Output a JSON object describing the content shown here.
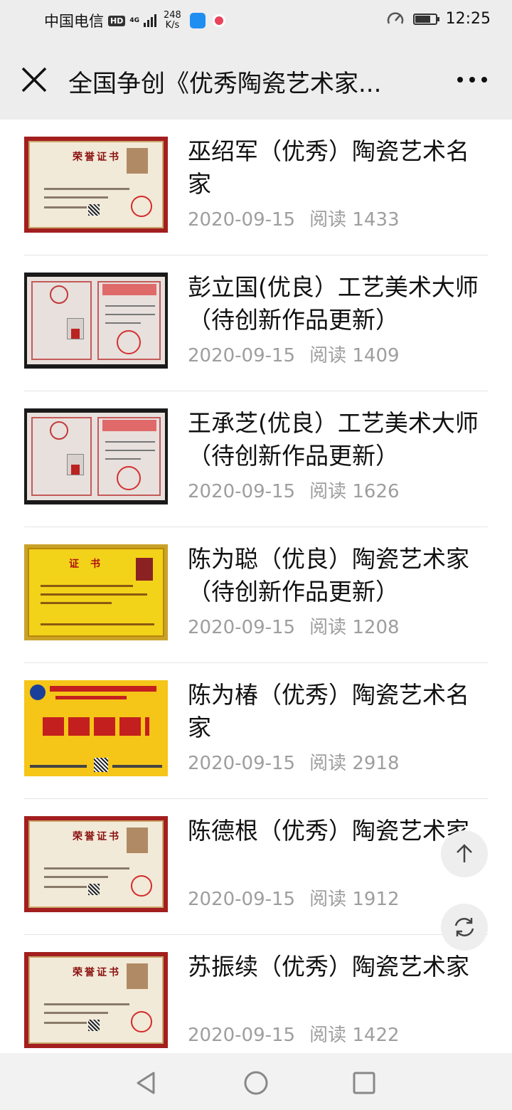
{
  "status_bar": {
    "carrier": "中国电信",
    "hd": "HD",
    "network": "4G",
    "speed_value": "248",
    "speed_unit": "K/s",
    "battery_level": 0.75,
    "time": "12:25"
  },
  "header": {
    "title": "全国争创《优秀陶瓷艺术家...",
    "close_icon": "close-icon",
    "more_icon": "more-icon"
  },
  "articles": [
    {
      "title": "巫绍军（优秀）陶瓷艺术名家",
      "date": "2020-09-15",
      "reads": "阅读 1433",
      "thumb": "certificate-cream"
    },
    {
      "title": "彭立国(优良）工艺美术大师（待创新作品更新）",
      "date": "2020-09-15",
      "reads": "阅读 1409",
      "thumb": "certificate-open"
    },
    {
      "title": "王承芝(优良）工艺美术大师（待创新作品更新）",
      "date": "2020-09-15",
      "reads": "阅读 1626",
      "thumb": "certificate-open"
    },
    {
      "title": "陈为聪（优良）陶瓷艺术家（待创新作品更新）",
      "date": "2020-09-15",
      "reads": "阅读 1208",
      "thumb": "certificate-gold"
    },
    {
      "title": "陈为椿（优秀）陶瓷艺术名家",
      "date": "2020-09-15",
      "reads": "阅读 2918",
      "thumb": "certificate-banner"
    },
    {
      "title": "陈德根（优秀）陶瓷艺术家",
      "date": "2020-09-15",
      "reads": "阅读 1912",
      "thumb": "certificate-cream"
    },
    {
      "title": "苏振续（优秀）陶瓷艺术家",
      "date": "2020-09-15",
      "reads": "阅读 1422",
      "thumb": "certificate-cream"
    }
  ],
  "floating": {
    "top_icon": "arrow-up-icon",
    "refresh_icon": "refresh-icon"
  },
  "nav": {
    "back_icon": "back-triangle-icon",
    "home_icon": "home-circle-icon",
    "recents_icon": "recents-square-icon"
  }
}
